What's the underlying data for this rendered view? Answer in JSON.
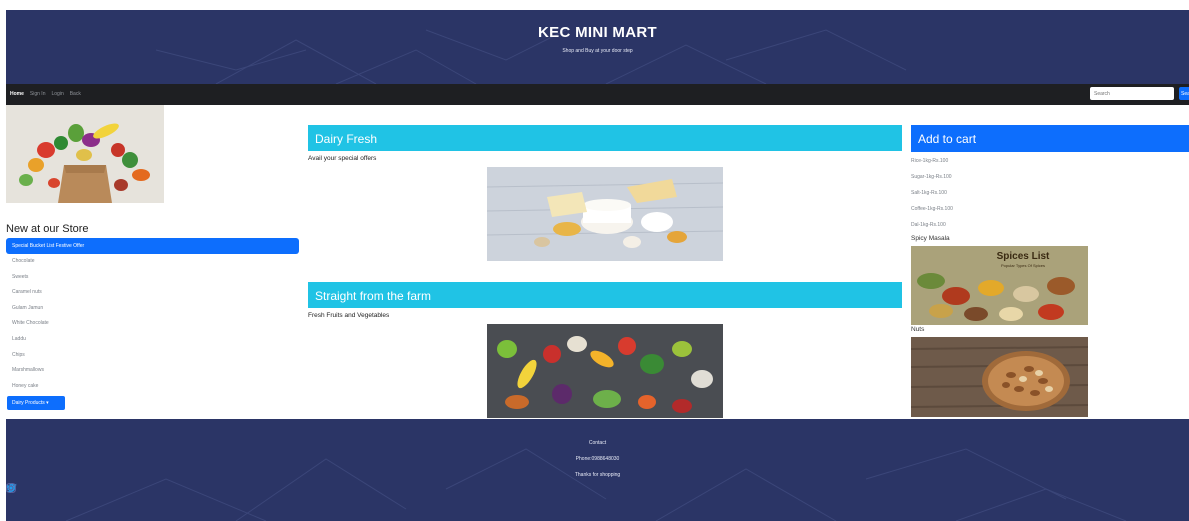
{
  "header": {
    "title": "KEC MINI MART",
    "tagline": "Shop and Buy at your door step"
  },
  "nav": {
    "links": [
      "Home",
      "Sign In",
      "Login",
      "Back"
    ],
    "search_placeholder": "Search",
    "search_button": "Search"
  },
  "store": {
    "heading": "New at our Store",
    "items": [
      "Special Bucket List Festive Offer",
      "Chocolate",
      "Sweets",
      "Caramel nuts",
      "Gulam Jamun",
      "White Chocolate",
      "Laddu",
      "Chips",
      "Marshmallows",
      "Honey cake"
    ],
    "dropdown": "Dairy Products ▾"
  },
  "sections": [
    {
      "title": "Dairy Fresh",
      "subtitle": "Avail your special offers"
    },
    {
      "title": "Straight from the farm",
      "subtitle": "Fresh Fruits and Vegetables"
    }
  ],
  "cart": {
    "title": "Add to cart",
    "items": [
      "Rice-1kg-Rs.100",
      "Sugar-1kg-Rs.100",
      "Salt-1kg-Rs.100",
      "Coffee-1kg-Rs.100",
      "Dal-1kg-Rs.100"
    ],
    "spicy_label": "Spicy Masala",
    "spices_title": "Spices List",
    "spices_subtitle": "Popular Types Of Spices",
    "nuts_label": "Nuts"
  },
  "footer": {
    "contact": "Contact",
    "phone": "Phone:0988648030",
    "thanks": "Thanks for shopping"
  },
  "colors": {
    "header_bg": "#2b3566",
    "navbar_bg": "#1e1f22",
    "primary_blue": "#0d6efd",
    "banner_cyan": "#20c3e5"
  },
  "icons": [
    "facebook-icon",
    "twitter-icon",
    "instagram-icon"
  ]
}
